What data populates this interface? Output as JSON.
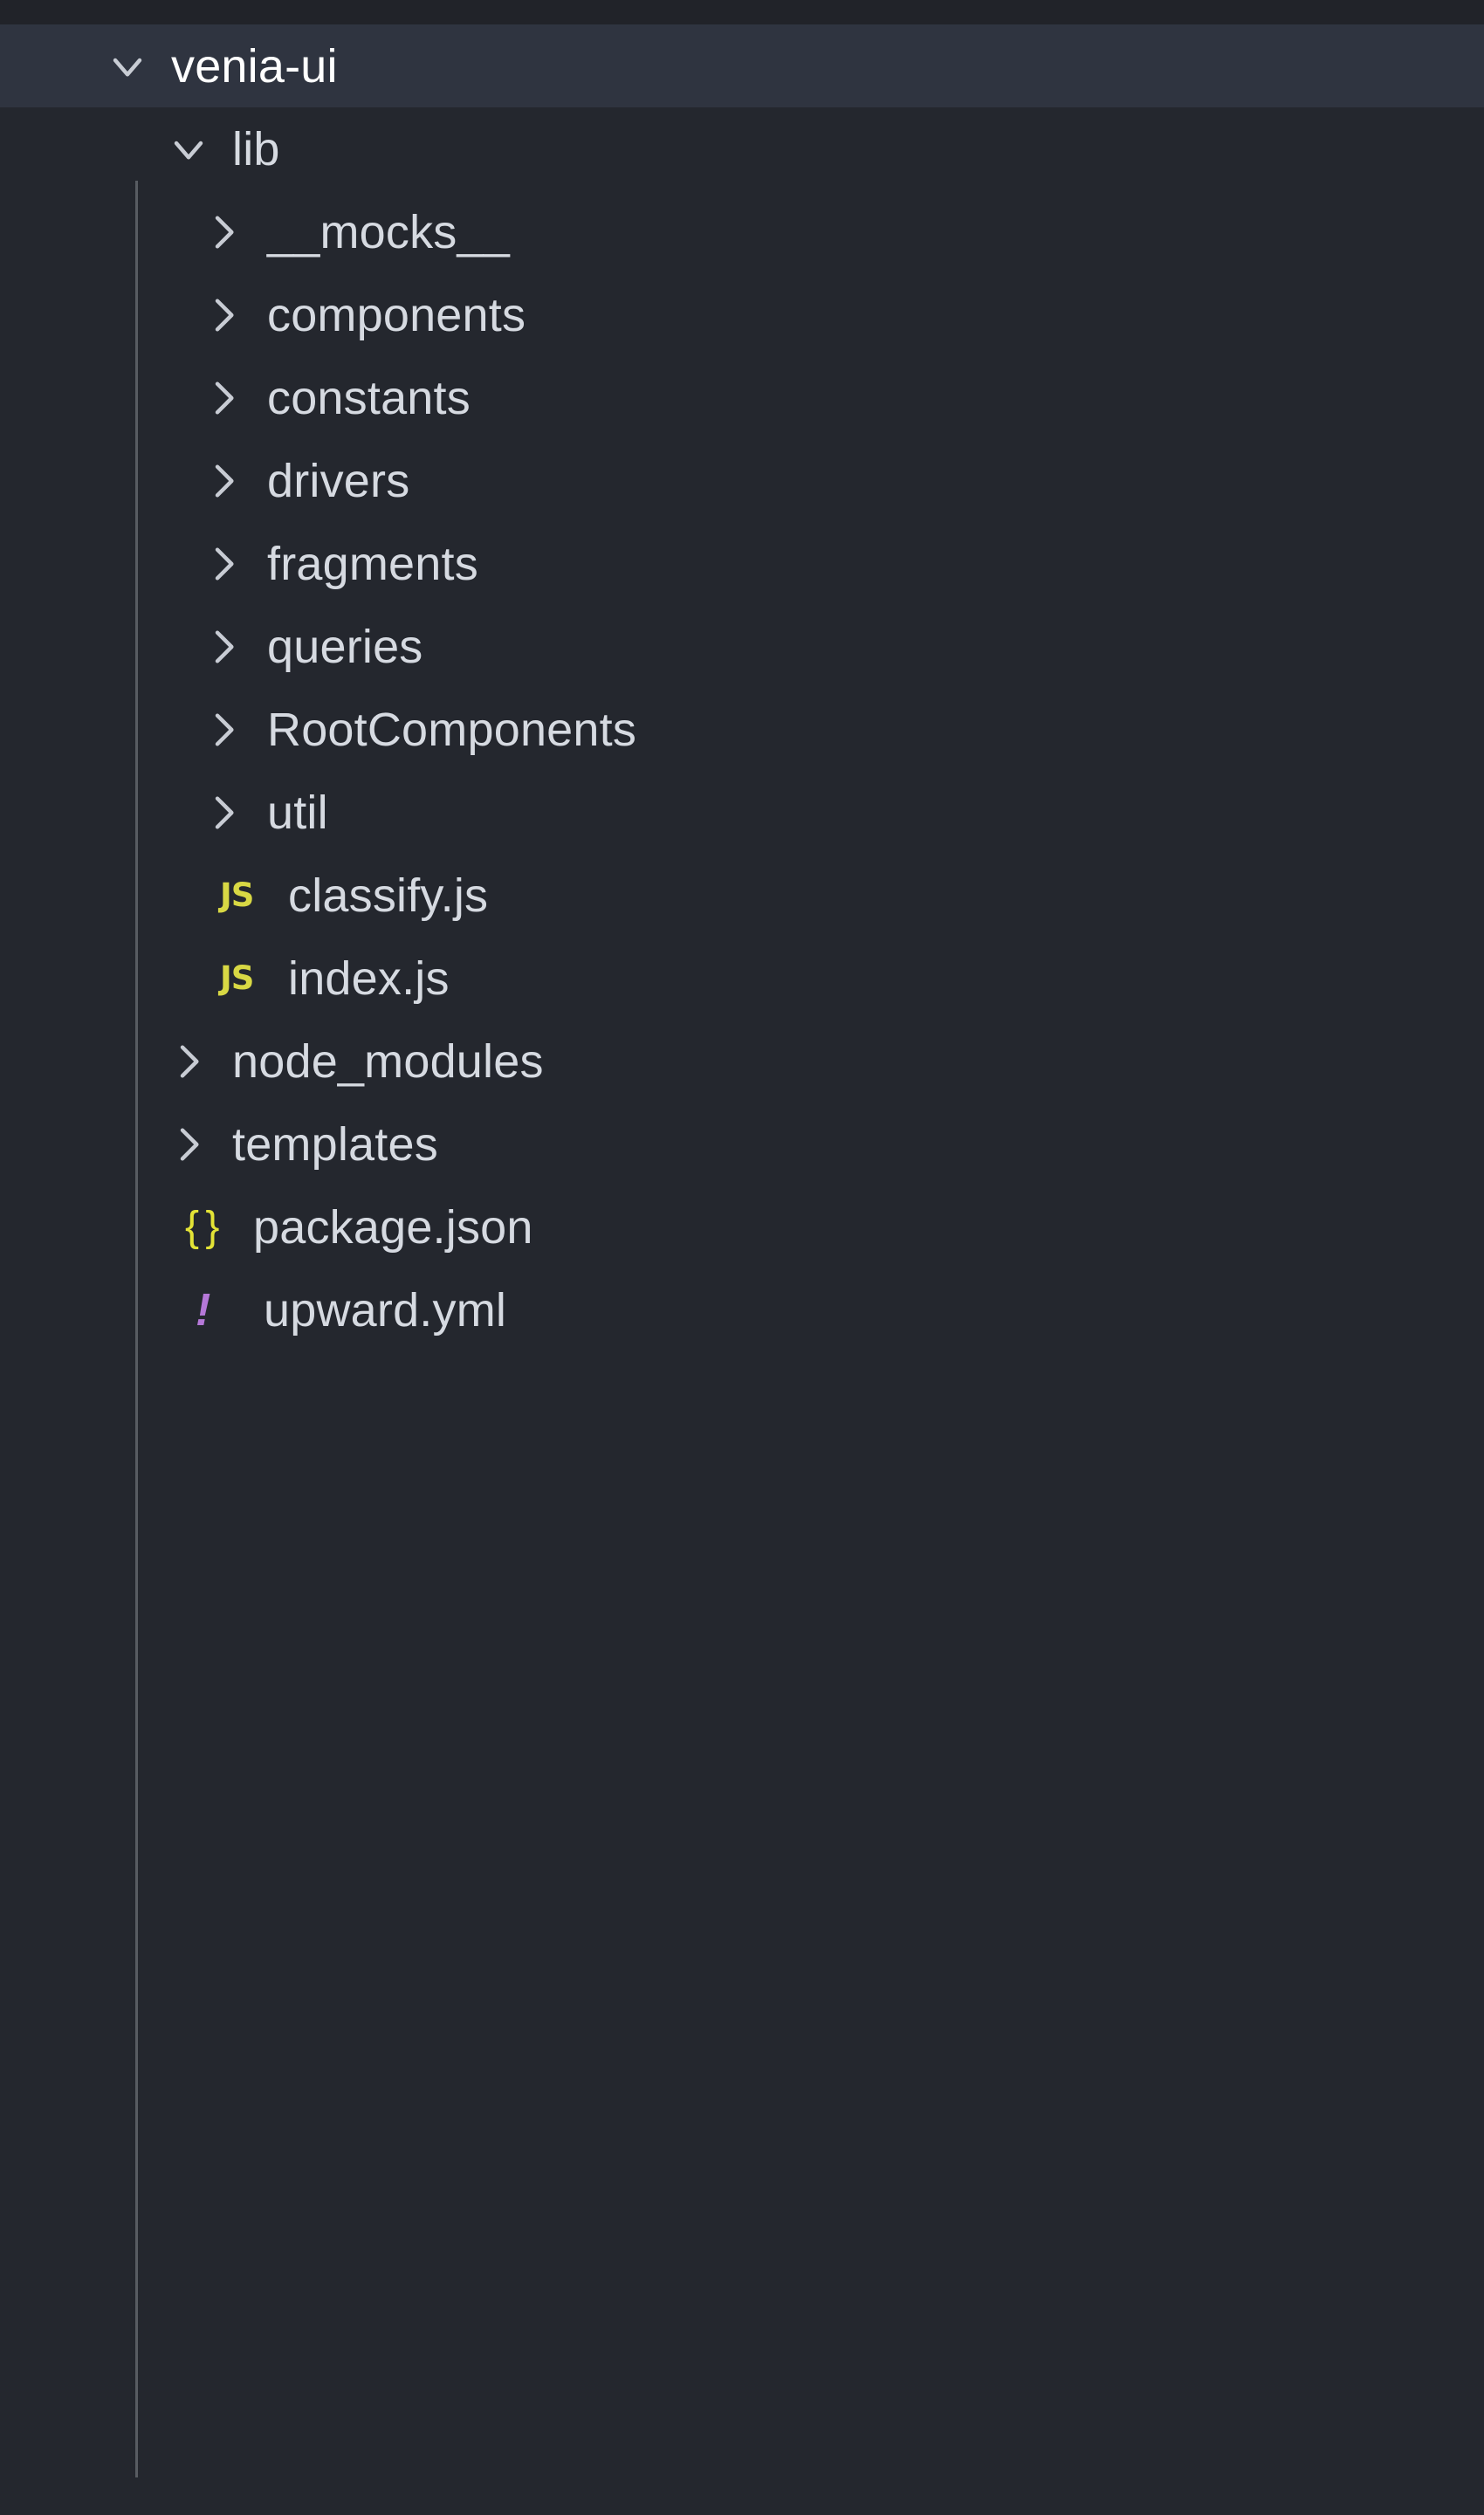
{
  "explorer": {
    "theme": {
      "background": "#24272e",
      "selected_row_background": "#2f3440",
      "text": "#d6dae1",
      "indent_guide": "#585c62",
      "js_icon_color": "#d8d844",
      "json_icon_color": "#e3e336",
      "yml_icon_color": "#b578d8"
    },
    "rows": [
      {
        "label": "venia-ui",
        "type": "folder",
        "state": "expanded",
        "depth": 0,
        "selected": true,
        "twisty": "chevron-down-icon"
      },
      {
        "label": "lib",
        "type": "folder",
        "state": "expanded",
        "depth": 1,
        "selected": false,
        "twisty": "chevron-down-icon"
      },
      {
        "label": "__mocks__",
        "type": "folder",
        "state": "collapsed",
        "depth": 2,
        "selected": false,
        "twisty": "chevron-right-icon"
      },
      {
        "label": "components",
        "type": "folder",
        "state": "collapsed",
        "depth": 2,
        "selected": false,
        "twisty": "chevron-right-icon"
      },
      {
        "label": "constants",
        "type": "folder",
        "state": "collapsed",
        "depth": 2,
        "selected": false,
        "twisty": "chevron-right-icon"
      },
      {
        "label": "drivers",
        "type": "folder",
        "state": "collapsed",
        "depth": 2,
        "selected": false,
        "twisty": "chevron-right-icon"
      },
      {
        "label": "fragments",
        "type": "folder",
        "state": "collapsed",
        "depth": 2,
        "selected": false,
        "twisty": "chevron-right-icon"
      },
      {
        "label": "queries",
        "type": "folder",
        "state": "collapsed",
        "depth": 2,
        "selected": false,
        "twisty": "chevron-right-icon"
      },
      {
        "label": "RootComponents",
        "type": "folder",
        "state": "collapsed",
        "depth": 2,
        "selected": false,
        "twisty": "chevron-right-icon"
      },
      {
        "label": "util",
        "type": "folder",
        "state": "collapsed",
        "depth": 2,
        "selected": false,
        "twisty": "chevron-right-icon"
      },
      {
        "label": "classify.js",
        "type": "file",
        "depth": 2,
        "selected": false,
        "icon": "js-file-icon",
        "icon_glyph": "JS"
      },
      {
        "label": "index.js",
        "type": "file",
        "depth": 2,
        "selected": false,
        "icon": "js-file-icon",
        "icon_glyph": "JS"
      },
      {
        "label": "node_modules",
        "type": "folder",
        "state": "collapsed",
        "depth": 1,
        "selected": false,
        "twisty": "chevron-right-icon"
      },
      {
        "label": "templates",
        "type": "folder",
        "state": "collapsed",
        "depth": 1,
        "selected": false,
        "twisty": "chevron-right-icon"
      },
      {
        "label": "package.json",
        "type": "file",
        "depth": 1,
        "selected": false,
        "icon": "json-file-icon",
        "icon_glyph": "{ }"
      },
      {
        "label": "upward.yml",
        "type": "file",
        "depth": 1,
        "selected": false,
        "icon": "yml-file-icon",
        "icon_glyph": "!"
      }
    ]
  }
}
